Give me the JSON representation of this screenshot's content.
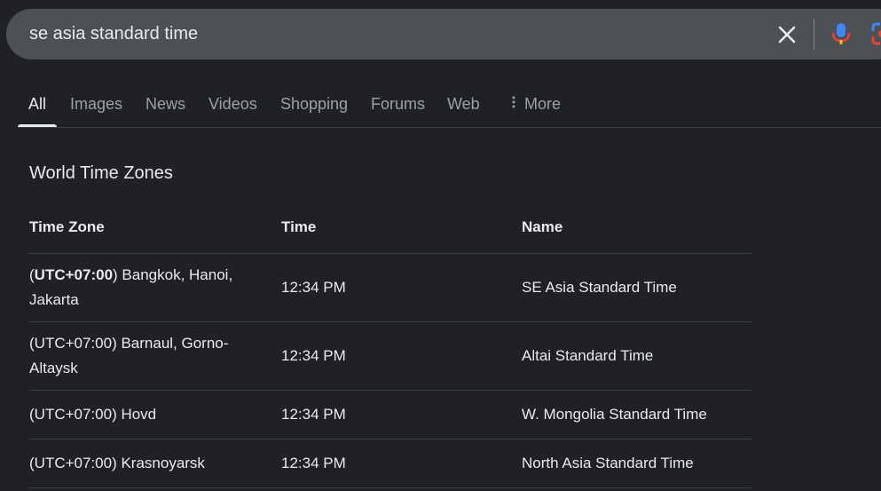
{
  "search": {
    "query": "se asia standard time",
    "clear_icon": "close-icon",
    "mic_icon": "mic-icon",
    "lens_icon": "lens-icon"
  },
  "tabs": [
    {
      "label": "All",
      "active": true
    },
    {
      "label": "Images"
    },
    {
      "label": "News"
    },
    {
      "label": "Videos"
    },
    {
      "label": "Shopping"
    },
    {
      "label": "Forums"
    },
    {
      "label": "Web"
    },
    {
      "label": "More",
      "icon": "more-vert-icon"
    }
  ],
  "card": {
    "title": "World Time Zones",
    "headers": {
      "zone": "Time Zone",
      "time": "Time",
      "name": "Name"
    },
    "rows": [
      {
        "utc_open": "(",
        "utc": "UTC+07:00",
        "utc_close": ")",
        "cities": " Bangkok, Hanoi, Jakarta",
        "time": "12:34 PM",
        "name": "SE Asia Standard Time"
      },
      {
        "zone": "(UTC+07:00) Barnaul, Gorno-Altaysk",
        "time": "12:34 PM",
        "name": "Altai Standard Time"
      },
      {
        "zone": "(UTC+07:00) Hovd",
        "time": "12:34 PM",
        "name": "W. Mongolia Standard Time"
      },
      {
        "zone": "(UTC+07:00) Krasnoyarsk",
        "time": "12:34 PM",
        "name": "North Asia Standard Time"
      }
    ]
  },
  "colors": {
    "background": "#202124",
    "search_bg": "#4d5156",
    "text": "#e8eaed",
    "muted": "#9aa0a6",
    "rule": "#3c4043"
  }
}
